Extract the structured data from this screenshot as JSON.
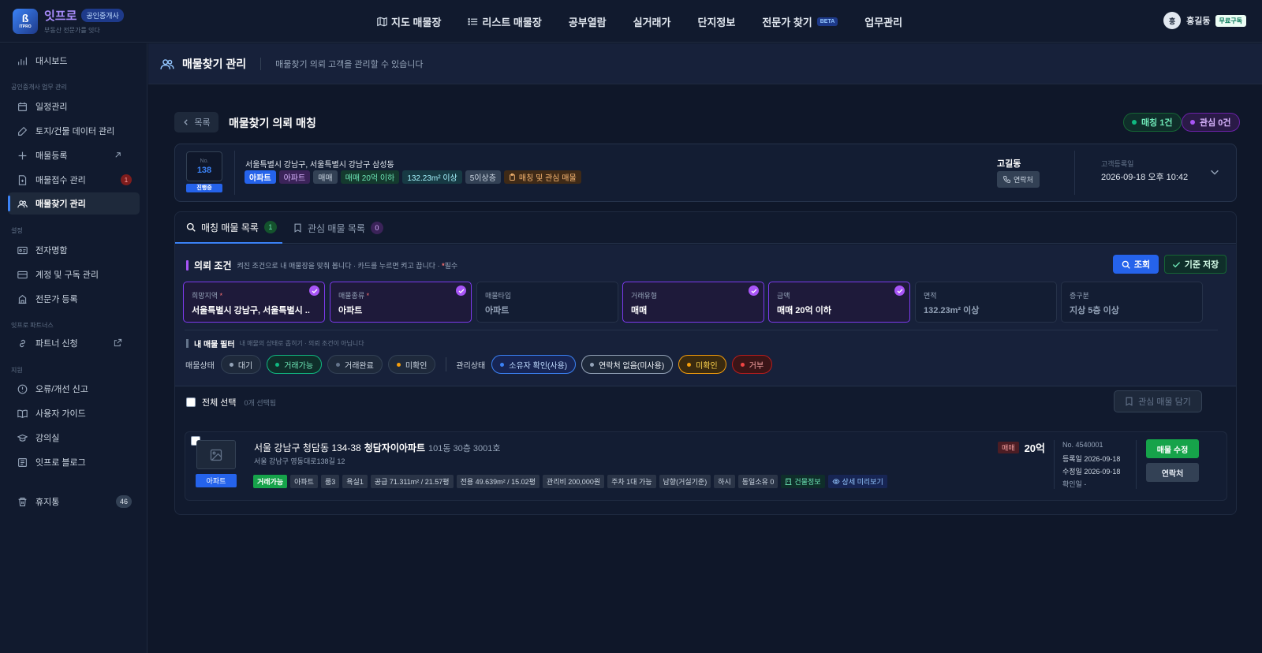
{
  "brand": {
    "name": "잇프로",
    "badge": "공인중개사",
    "tagline": "부동산 전문가를 잇다",
    "mark": "ITPRO"
  },
  "topnav": [
    {
      "label": "지도 매물장",
      "icon": "map-icon"
    },
    {
      "label": "리스트 매물장",
      "icon": "list-icon"
    },
    {
      "label": "공부열람"
    },
    {
      "label": "실거래가"
    },
    {
      "label": "단지정보"
    },
    {
      "label": "전문가 찾기",
      "badge": "BETA"
    },
    {
      "label": "업무관리"
    }
  ],
  "user": {
    "initial": "홍",
    "name": "홍길동",
    "plan": "무료구독"
  },
  "sidebar": {
    "dashboard": "대시보드",
    "sections": [
      "공인중개사 업무 관리",
      "설정",
      "잇프로 파트너스",
      "지원"
    ],
    "items": [
      {
        "label": "일정관리"
      },
      {
        "label": "토지/건물 데이터 관리"
      },
      {
        "label": "매물등록"
      },
      {
        "label": "매물접수 관리",
        "badge": "1"
      },
      {
        "label": "매물찾기 관리"
      },
      {
        "label": "전자명함"
      },
      {
        "label": "계정 및 구독 관리"
      },
      {
        "label": "전문가 등록"
      },
      {
        "label": "파트너 신청"
      },
      {
        "label": "오류/개선 신고"
      },
      {
        "label": "사용자 가이드"
      },
      {
        "label": "강의실"
      },
      {
        "label": "잇프로 블로그"
      },
      {
        "label": "휴지통",
        "badge": "46"
      }
    ]
  },
  "page": {
    "title": "매물찾기 관리",
    "description": "매물찾기 의뢰 고객을 관리할 수 있습니다"
  },
  "main": {
    "back_label": "목록",
    "title": "매물찾기 의뢰 매칭",
    "match_pill": "매칭 1건",
    "interest_pill": "관심 0건"
  },
  "request": {
    "no_label": "No.",
    "no": "138",
    "status": "진행중",
    "address": "서울특별시 강남구, 서울특별시 강남구 삼성동",
    "tags": [
      "아파트",
      "아파트",
      "매매",
      "매매 20억 이하",
      "132.23m² 이상",
      "5이상층",
      "매칭 및 관심 매물"
    ],
    "client": "고길동",
    "contact_label": "연락처",
    "reg_label": "고객등록일",
    "reg_date": "2026-09-18 오후 10:42"
  },
  "tabs": [
    {
      "label": "매칭 매물 목록",
      "count": "1"
    },
    {
      "label": "관심 매물 목록",
      "count": "0"
    }
  ],
  "conditions": {
    "title": "의뢰 조건",
    "desc": "켜진 조건으로 내 매물장을 맞춰 봅니다 · 카드를 누르면 켜고 끕니다 · ",
    "required_mark": "*",
    "required_label": "필수",
    "search_label": "조회",
    "save_label": "기준 저장",
    "cards": [
      {
        "label": "희망지역",
        "required": "*",
        "value": "서울특별시 강남구, 서울특별시 ...",
        "selected": true
      },
      {
        "label": "매물종류",
        "required": "*",
        "value": "아파트",
        "selected": true
      },
      {
        "label": "매물타입",
        "required": "",
        "value": "아파트",
        "selected": false
      },
      {
        "label": "거래유형",
        "required": "",
        "value": "매매",
        "selected": true
      },
      {
        "label": "금액",
        "required": "",
        "value": "매매 20억 이하",
        "selected": true
      },
      {
        "label": "면적",
        "required": "",
        "value": "132.23m² 이상",
        "selected": false
      },
      {
        "label": "층구분",
        "required": "",
        "value": "지상 5층 이상",
        "selected": false
      }
    ]
  },
  "filter": {
    "title": "내 매물 필터",
    "desc": "내 매물의 상태로 좁히기 · 의뢰 조건이 아닙니다",
    "status_label": "매물상태",
    "status_chips": [
      {
        "label": "대기",
        "color": "#94a3b8"
      },
      {
        "label": "거래가능",
        "color": "#10b981"
      },
      {
        "label": "거래완료",
        "color": "#64748b"
      },
      {
        "label": "미확인",
        "color": "#f59e0b"
      }
    ],
    "manage_label": "관리상태",
    "manage_chips": [
      {
        "label": "소유자 확인(사용)",
        "color": "#3b82f6"
      },
      {
        "label": "연락처 없음(미사용)",
        "color": "#94a3b8"
      },
      {
        "label": "미확인",
        "color": "#f59e0b"
      },
      {
        "label": "거부",
        "color": "#ef4444"
      }
    ]
  },
  "list": {
    "select_all": "전체 선택",
    "selected_count": "0개 선택됨",
    "add_interest": "관심 매물 담기",
    "item": {
      "type_tag": "아파트",
      "address": "서울 강남구 청담동 134-38",
      "name": "청담자이아파트",
      "unit": "101동 30층 3001호",
      "road": "서울 강남구 영동대로138길 12",
      "tags": [
        "거래가능",
        "아파트",
        "룸3",
        "욕실1",
        "공급 71.311m² / 21.57평",
        "전용 49.639m² / 15.02평",
        "관리비 200,000원",
        "주차 1대 가능",
        "남향(거실기준)",
        "하시",
        "동일소유 0",
        "건물정보",
        "상세 미리보기"
      ],
      "deal": "매매",
      "price": "20억",
      "no": "No. 4540001",
      "registered": "등록일 2026-09-18",
      "modified": "수정일 2026-09-18",
      "confirmed": "확인일 -",
      "edit_label": "매물 수정",
      "contact_label": "연락처"
    }
  },
  "colors": {
    "accent": "#3b82f6",
    "purple": "#a855f7",
    "green": "#16a34a",
    "bg": "#0f1729"
  }
}
